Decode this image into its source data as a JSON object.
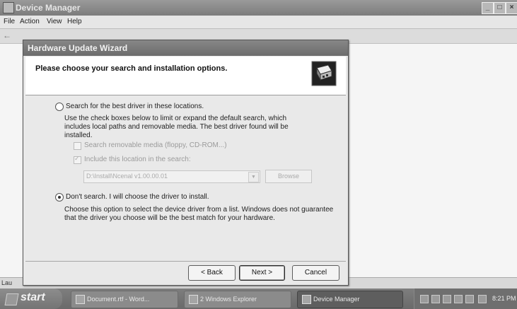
{
  "window": {
    "title": "Device Manager",
    "menu": [
      "File",
      "Action",
      "View",
      "Help"
    ],
    "status_text": "Lau"
  },
  "wizard": {
    "title": "Hardware Update Wizard",
    "heading": "Please choose your search and installation options.",
    "search_option": {
      "label": "Search for the best driver in these locations.",
      "description": "Use the check boxes below to limit or expand the default search, which includes local paths and removable media. The best driver found will be installed.",
      "removable_media_label": "Search removable media (floppy, CD-ROM...)",
      "include_location_label": "Include this location in the search:",
      "location_value": "D:\\Install\\Ncenal v1.00.00.01",
      "browse_label": "Browse"
    },
    "manual_option": {
      "label": "Don't search. I will choose the driver to install.",
      "description": "Choose this option to select the device driver from a list. Windows does not guarantee that the driver you choose will be the best match for your hardware."
    },
    "buttons": {
      "back": "< Back",
      "next": "Next >",
      "cancel": "Cancel"
    }
  },
  "taskbar": {
    "start_label": "start",
    "tasks": [
      {
        "label": "Document.rtf - Word..."
      },
      {
        "label": "2 Windows Explorer"
      },
      {
        "label": "Device Manager"
      }
    ],
    "clock": "8:21 PM"
  }
}
